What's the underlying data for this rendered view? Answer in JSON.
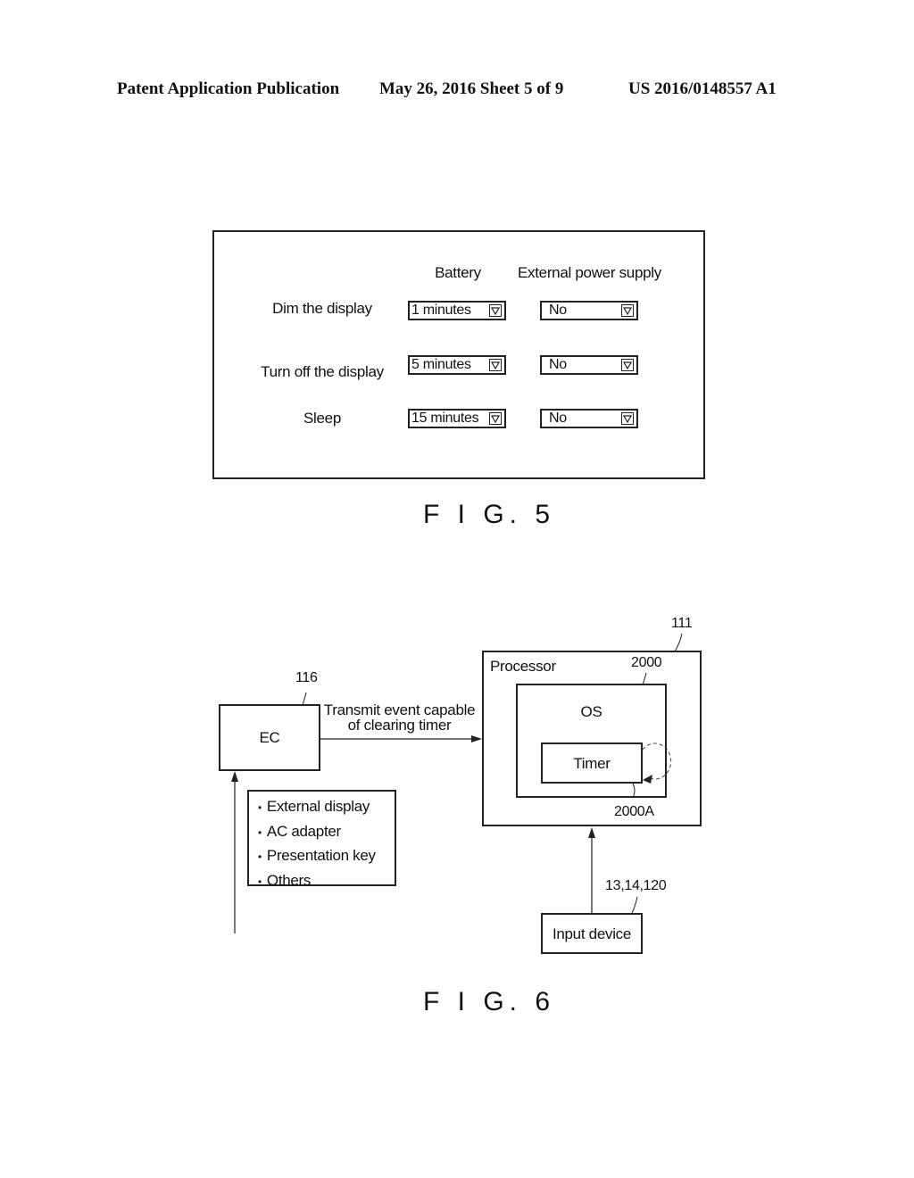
{
  "header": {
    "publication": "Patent Application Publication",
    "date_sheet": "May 26, 2016  Sheet 5 of 9",
    "number": "US 2016/0148557 A1"
  },
  "fig5": {
    "columns": [
      "Battery",
      "External power supply"
    ],
    "rows": [
      {
        "label": "Dim the display",
        "battery": "1 minutes",
        "external": "No"
      },
      {
        "label": "Turn off the display",
        "battery": "5 minutes",
        "external": "No"
      },
      {
        "label": "Sleep",
        "battery": "15 minutes",
        "external": "No"
      }
    ],
    "caption": "F I G. 5"
  },
  "fig6": {
    "ec": {
      "label": "EC",
      "ref": "116"
    },
    "arrow_label_line1": "Transmit event capable",
    "arrow_label_line2": "of clearing timer",
    "events": [
      "External display",
      "AC adapter",
      "Presentation key",
      "Others"
    ],
    "bullet": "•",
    "processor": {
      "label": "Processor",
      "ref": "111"
    },
    "os": {
      "label": "OS",
      "ref": "2000"
    },
    "timer": {
      "label": "Timer",
      "ref": "2000A"
    },
    "input_device": {
      "label": "Input device",
      "ref": "13,14,120"
    },
    "caption": "F I G. 6"
  }
}
